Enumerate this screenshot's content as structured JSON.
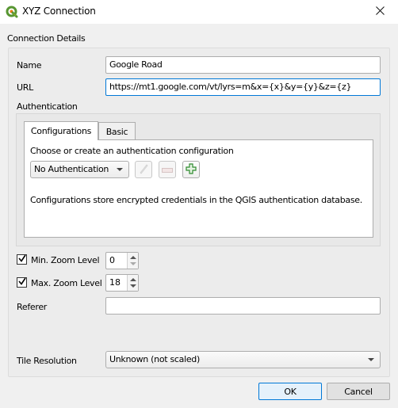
{
  "window": {
    "title": "XYZ Connection",
    "app_icon": "qgis-logo-icon",
    "close_icon": "close-icon"
  },
  "connection_details": {
    "section_label": "Connection Details",
    "name": {
      "label": "Name",
      "value": "Google Road"
    },
    "url": {
      "label": "URL",
      "value": "https://mt1.google.com/vt/lyrs=m&x={x}&y={y}&z={z}"
    },
    "authentication": {
      "label": "Authentication",
      "tabs": [
        {
          "label": "Configurations",
          "active": true
        },
        {
          "label": "Basic",
          "active": false
        }
      ],
      "configurations": {
        "prompt": "Choose or create an authentication configuration",
        "selected": "No Authentication",
        "edit_icon": "pencil-icon",
        "remove_icon": "minus-icon",
        "add_icon": "plus-icon",
        "info": "Configurations store encrypted credentials in the QGIS authentication database."
      }
    },
    "min_zoom": {
      "label": "Min. Zoom Level",
      "checked": true,
      "value": "0"
    },
    "max_zoom": {
      "label": "Max. Zoom Level",
      "checked": true,
      "value": "18"
    },
    "referer": {
      "label": "Referer",
      "value": ""
    },
    "tile_resolution": {
      "label": "Tile Resolution",
      "selected": "Unknown (not scaled)"
    }
  },
  "buttons": {
    "ok": "OK",
    "cancel": "Cancel"
  },
  "colors": {
    "focus_border": "#0078d7",
    "add_icon_green": "#2e8b2e"
  }
}
